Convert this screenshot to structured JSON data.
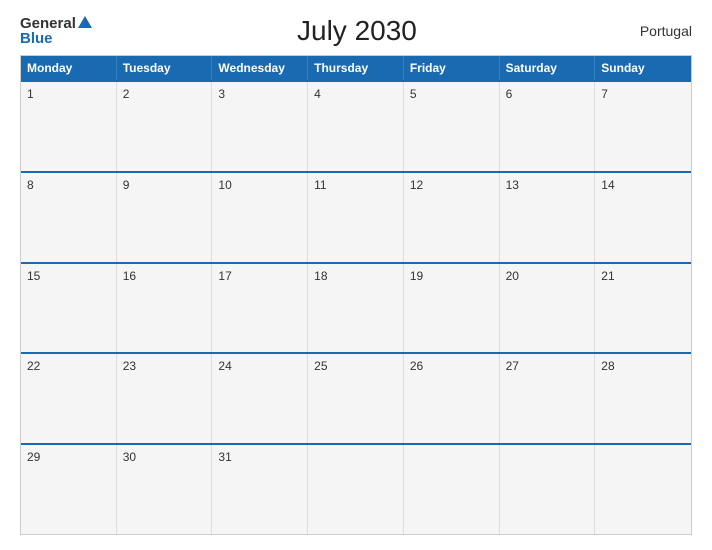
{
  "header": {
    "logo_general": "General",
    "logo_blue": "Blue",
    "title": "July 2030",
    "country": "Portugal"
  },
  "calendar": {
    "headers": [
      "Monday",
      "Tuesday",
      "Wednesday",
      "Thursday",
      "Friday",
      "Saturday",
      "Sunday"
    ],
    "weeks": [
      [
        {
          "day": "1",
          "empty": false
        },
        {
          "day": "2",
          "empty": false
        },
        {
          "day": "3",
          "empty": false
        },
        {
          "day": "4",
          "empty": false
        },
        {
          "day": "5",
          "empty": false
        },
        {
          "day": "6",
          "empty": false
        },
        {
          "day": "7",
          "empty": false
        }
      ],
      [
        {
          "day": "8",
          "empty": false
        },
        {
          "day": "9",
          "empty": false
        },
        {
          "day": "10",
          "empty": false
        },
        {
          "day": "11",
          "empty": false
        },
        {
          "day": "12",
          "empty": false
        },
        {
          "day": "13",
          "empty": false
        },
        {
          "day": "14",
          "empty": false
        }
      ],
      [
        {
          "day": "15",
          "empty": false
        },
        {
          "day": "16",
          "empty": false
        },
        {
          "day": "17",
          "empty": false
        },
        {
          "day": "18",
          "empty": false
        },
        {
          "day": "19",
          "empty": false
        },
        {
          "day": "20",
          "empty": false
        },
        {
          "day": "21",
          "empty": false
        }
      ],
      [
        {
          "day": "22",
          "empty": false
        },
        {
          "day": "23",
          "empty": false
        },
        {
          "day": "24",
          "empty": false
        },
        {
          "day": "25",
          "empty": false
        },
        {
          "day": "26",
          "empty": false
        },
        {
          "day": "27",
          "empty": false
        },
        {
          "day": "28",
          "empty": false
        }
      ],
      [
        {
          "day": "29",
          "empty": false
        },
        {
          "day": "30",
          "empty": false
        },
        {
          "day": "31",
          "empty": false
        },
        {
          "day": "",
          "empty": true
        },
        {
          "day": "",
          "empty": true
        },
        {
          "day": "",
          "empty": true
        },
        {
          "day": "",
          "empty": true
        }
      ]
    ]
  }
}
